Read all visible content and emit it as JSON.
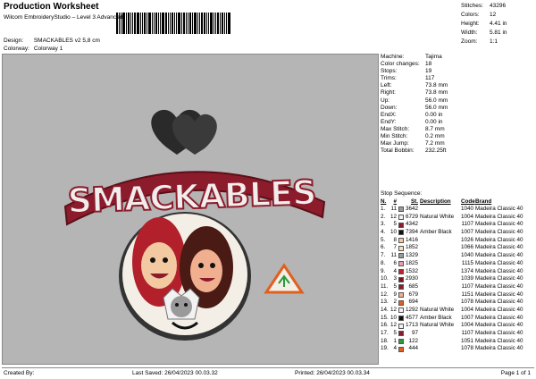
{
  "header": {
    "title": "Production Worksheet",
    "subtitle": "Wilcom EmbroideryStudio – Level 3 Advanced",
    "design_label": "Design:",
    "design_value": "SMACKABLES v2 5,8 cm",
    "colorway_label": "Colorway:",
    "colorway_value": "Colorway 1"
  },
  "stats": [
    {
      "label": "Stitches:",
      "value": "43296"
    },
    {
      "label": "Colors:",
      "value": "12"
    },
    {
      "label": "Height:",
      "value": "4.41 in"
    },
    {
      "label": "Width:",
      "value": "5.81 in"
    },
    {
      "label": "Zoom:",
      "value": "1:1"
    }
  ],
  "machine": [
    {
      "label": "Machine:",
      "value": "Tajima"
    },
    {
      "label": "Color changes:",
      "value": "18"
    },
    {
      "label": "Stops:",
      "value": "19"
    },
    {
      "label": "Trims:",
      "value": "117"
    },
    {
      "label": "Left:",
      "value": "73.8 mm"
    },
    {
      "label": "Right:",
      "value": "73.8 mm"
    },
    {
      "label": "Up:",
      "value": "56.0 mm"
    },
    {
      "label": "Down:",
      "value": "56.0 mm"
    },
    {
      "label": "EndX:",
      "value": "0.00 in"
    },
    {
      "label": "EndY:",
      "value": "0.00 in"
    },
    {
      "label": "Max Stitch:",
      "value": "8.7 mm"
    },
    {
      "label": "Min Stitch:",
      "value": "0.2 mm"
    },
    {
      "label": "Max Jump:",
      "value": "7.2 mm"
    },
    {
      "label": "Total Bobbin:",
      "value": "232.25ft"
    }
  ],
  "sequence": {
    "title": "Stop Sequence:",
    "headers": {
      "no": "N.",
      "color": "#",
      "st": "St.",
      "desc": "Description",
      "code": "Code",
      "brand": "Brand"
    },
    "rows": [
      {
        "no": "1.",
        "col": "11",
        "swatch": "#9a9a9a",
        "st": "3642",
        "desc": "",
        "code": "1040",
        "brand": "Madeira Classic 40"
      },
      {
        "no": "2.",
        "col": "12",
        "swatch": "#f2f2f2",
        "st": "6729",
        "desc": "Natural White",
        "code": "1004",
        "brand": "Madeira Classic 40"
      },
      {
        "no": "3.",
        "col": "5",
        "swatch": "#8c1c2c",
        "st": "4342",
        "desc": "",
        "code": "1107",
        "brand": "Madeira Classic 40"
      },
      {
        "no": "4.",
        "col": "10",
        "swatch": "#111111",
        "st": "7394",
        "desc": "Amber Black",
        "code": "1007",
        "brand": "Madeira Classic 40"
      },
      {
        "no": "5.",
        "col": "8",
        "swatch": "#f2c9a0",
        "st": "1416",
        "desc": "",
        "code": "1026",
        "brand": "Madeira Classic 40"
      },
      {
        "no": "6.",
        "col": "7",
        "swatch": "#f4e0c0",
        "st": "1852",
        "desc": "",
        "code": "1066",
        "brand": "Madeira Classic 40"
      },
      {
        "no": "7.",
        "col": "11",
        "swatch": "#9a9a9a",
        "st": "1329",
        "desc": "",
        "code": "1040",
        "brand": "Madeira Classic 40"
      },
      {
        "no": "8.",
        "col": "6",
        "swatch": "#e8a0b0",
        "st": "1825",
        "desc": "",
        "code": "1115",
        "brand": "Madeira Classic 40"
      },
      {
        "no": "9.",
        "col": "4",
        "swatch": "#c0202c",
        "st": "1532",
        "desc": "",
        "code": "1374",
        "brand": "Madeira Classic 40"
      },
      {
        "no": "10.",
        "col": "3",
        "swatch": "#7a1420",
        "st": "2930",
        "desc": "",
        "code": "1039",
        "brand": "Madeira Classic 40"
      },
      {
        "no": "11.",
        "col": "5",
        "swatch": "#8c1c2c",
        "st": "685",
        "desc": "",
        "code": "1107",
        "brand": "Madeira Classic 40"
      },
      {
        "no": "12.",
        "col": "9",
        "swatch": "#f0b090",
        "st": "679",
        "desc": "",
        "code": "1151",
        "brand": "Madeira Classic 40"
      },
      {
        "no": "13.",
        "col": "2",
        "swatch": "#e06020",
        "st": "694",
        "desc": "",
        "code": "1078",
        "brand": "Madeira Classic 40"
      },
      {
        "no": "14.",
        "col": "12",
        "swatch": "#f2f2f2",
        "st": "1292",
        "desc": "Natural White",
        "code": "1004",
        "brand": "Madeira Classic 40"
      },
      {
        "no": "15.",
        "col": "10",
        "swatch": "#111111",
        "st": "4577",
        "desc": "Amber Black",
        "code": "1007",
        "brand": "Madeira Classic 40"
      },
      {
        "no": "16.",
        "col": "12",
        "swatch": "#f2f2f2",
        "st": "1713",
        "desc": "Natural White",
        "code": "1004",
        "brand": "Madeira Classic 40"
      },
      {
        "no": "17.",
        "col": "5",
        "swatch": "#8c1c2c",
        "st": "97",
        "desc": "",
        "code": "1107",
        "brand": "Madeira Classic 40"
      },
      {
        "no": "18.",
        "col": "1",
        "swatch": "#2a9a3a",
        "st": "122",
        "desc": "",
        "code": "1051",
        "brand": "Madeira Classic 40"
      },
      {
        "no": "19.",
        "col": "4",
        "swatch": "#e06020",
        "st": "444",
        "desc": "",
        "code": "1078",
        "brand": "Madeira Classic 40"
      }
    ]
  },
  "design_art": {
    "wordmark": "SMACKABLES"
  },
  "footer": {
    "created_by": "Created By:",
    "last_saved": "Last Saved: 26/04/2023 00.03.32",
    "printed": "Printed: 26/04/2023 00.03.34",
    "page": "Page 1 of 1"
  }
}
